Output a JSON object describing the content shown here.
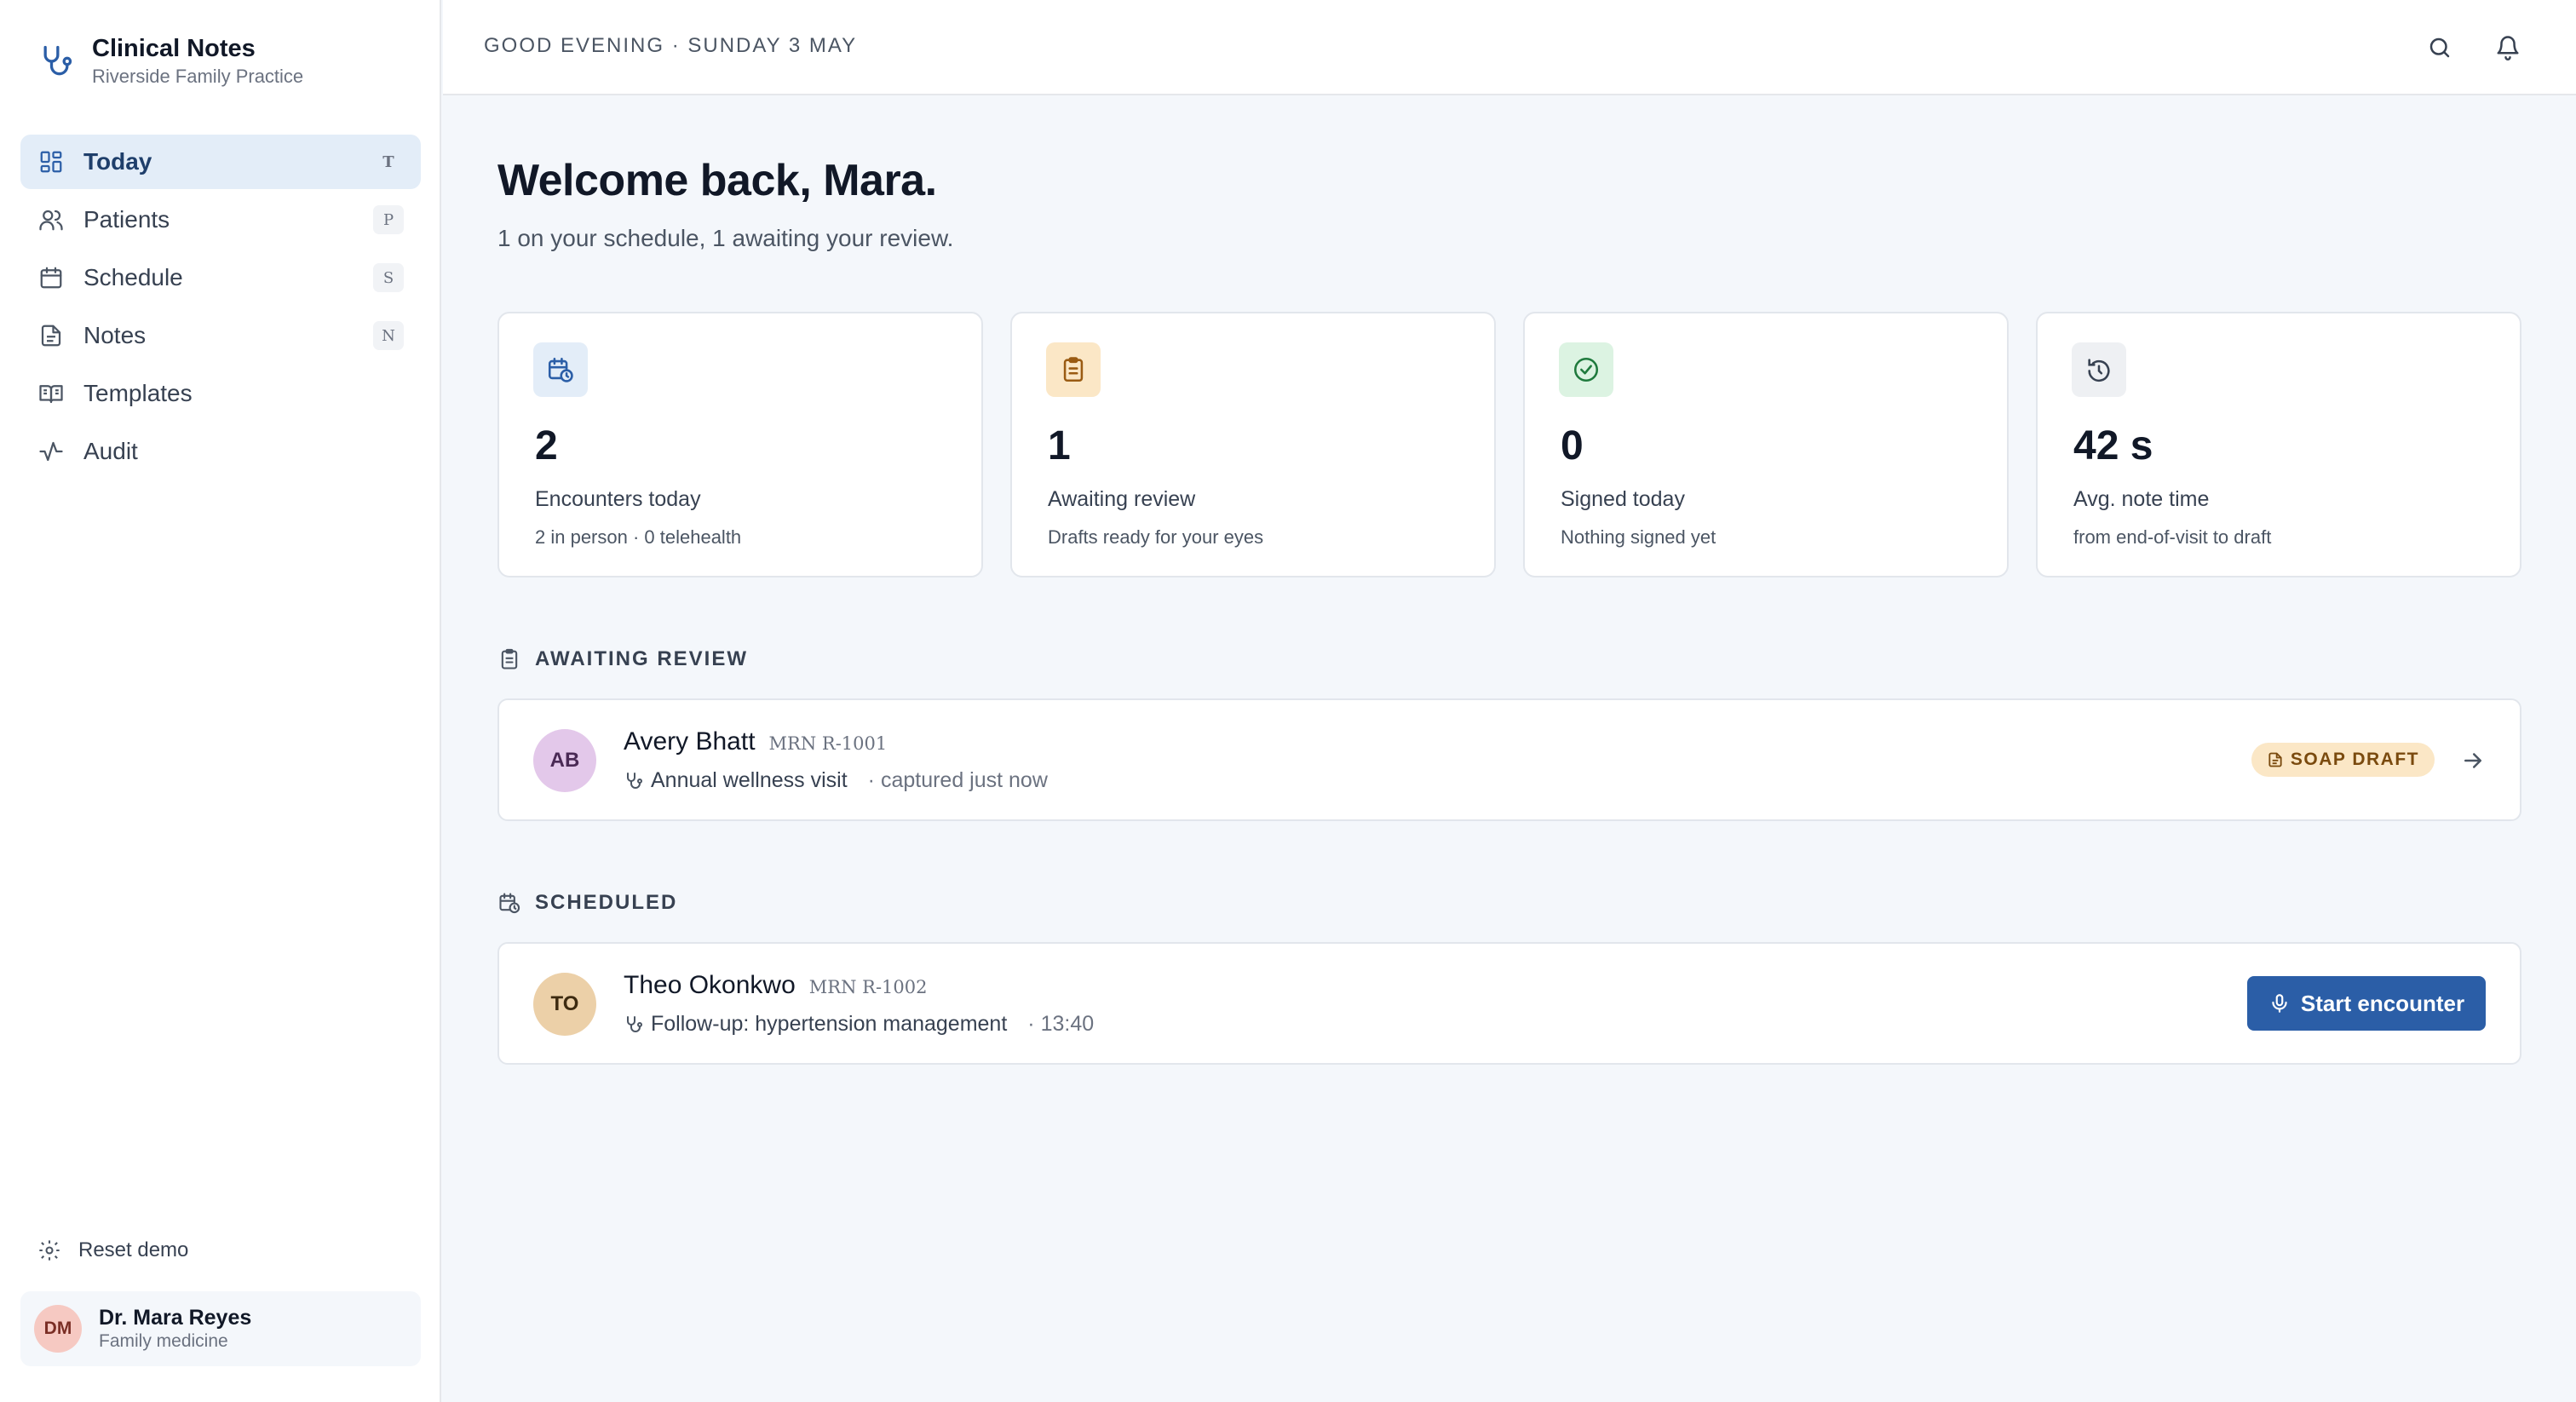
{
  "app": {
    "title": "Clinical Notes",
    "subtitle": "Riverside Family Practice"
  },
  "nav": [
    {
      "label": "Today",
      "key": "T",
      "icon": "dashboard-icon",
      "active": true
    },
    {
      "label": "Patients",
      "key": "P",
      "icon": "users-icon"
    },
    {
      "label": "Schedule",
      "key": "S",
      "icon": "calendar-icon"
    },
    {
      "label": "Notes",
      "key": "N",
      "icon": "document-icon"
    },
    {
      "label": "Templates",
      "key": "",
      "icon": "book-icon"
    },
    {
      "label": "Audit",
      "key": "",
      "icon": "activity-icon"
    }
  ],
  "sidebar_footer": {
    "reset_label": "Reset demo",
    "user": {
      "initials": "DM",
      "name": "Dr. Mara Reyes",
      "role": "Family medicine"
    }
  },
  "topbar": {
    "greeting": "GOOD EVENING · SUNDAY 3 MAY"
  },
  "main": {
    "welcome": "Welcome back, Mara.",
    "summary": "1 on your schedule, 1 awaiting your review."
  },
  "stats": [
    {
      "value": "2",
      "label": "Encounters today",
      "sub": "2 in person · 0 telehealth",
      "icon": "calendar-clock-icon",
      "color": "#e3edf8"
    },
    {
      "value": "1",
      "label": "Awaiting review",
      "sub": "Drafts ready for your eyes",
      "icon": "clipboard-icon",
      "color": "#fbe7c6"
    },
    {
      "value": "0",
      "label": "Signed today",
      "sub": "Nothing signed yet",
      "icon": "check-circle-icon",
      "color": "#dcf3e2"
    },
    {
      "value": "42 s",
      "label": "Avg. note time",
      "sub": "from end-of-visit to draft",
      "icon": "timer-icon",
      "color": "#eef0f3"
    }
  ],
  "awaiting": {
    "heading": "AWAITING REVIEW",
    "patient": {
      "initials": "AB",
      "name": "Avery Bhatt",
      "mrn": "MRN R-1001",
      "visit": "Annual wellness visit",
      "extra": "· captured just now",
      "badge": "SOAP DRAFT"
    }
  },
  "scheduled": {
    "heading": "SCHEDULED",
    "patient": {
      "initials": "TO",
      "name": "Theo Okonkwo",
      "mrn": "MRN R-1002",
      "visit": "Follow-up: hypertension management",
      "extra": "· 13:40",
      "button": "Start encounter"
    }
  },
  "colors": {
    "accent": "#2b5ea7",
    "nav_active_bg": "#e3edf8",
    "avatar_ab": "#e3c8ea",
    "avatar_to": "#ecd0a8",
    "avatar_dm": "#f6c9c2"
  }
}
